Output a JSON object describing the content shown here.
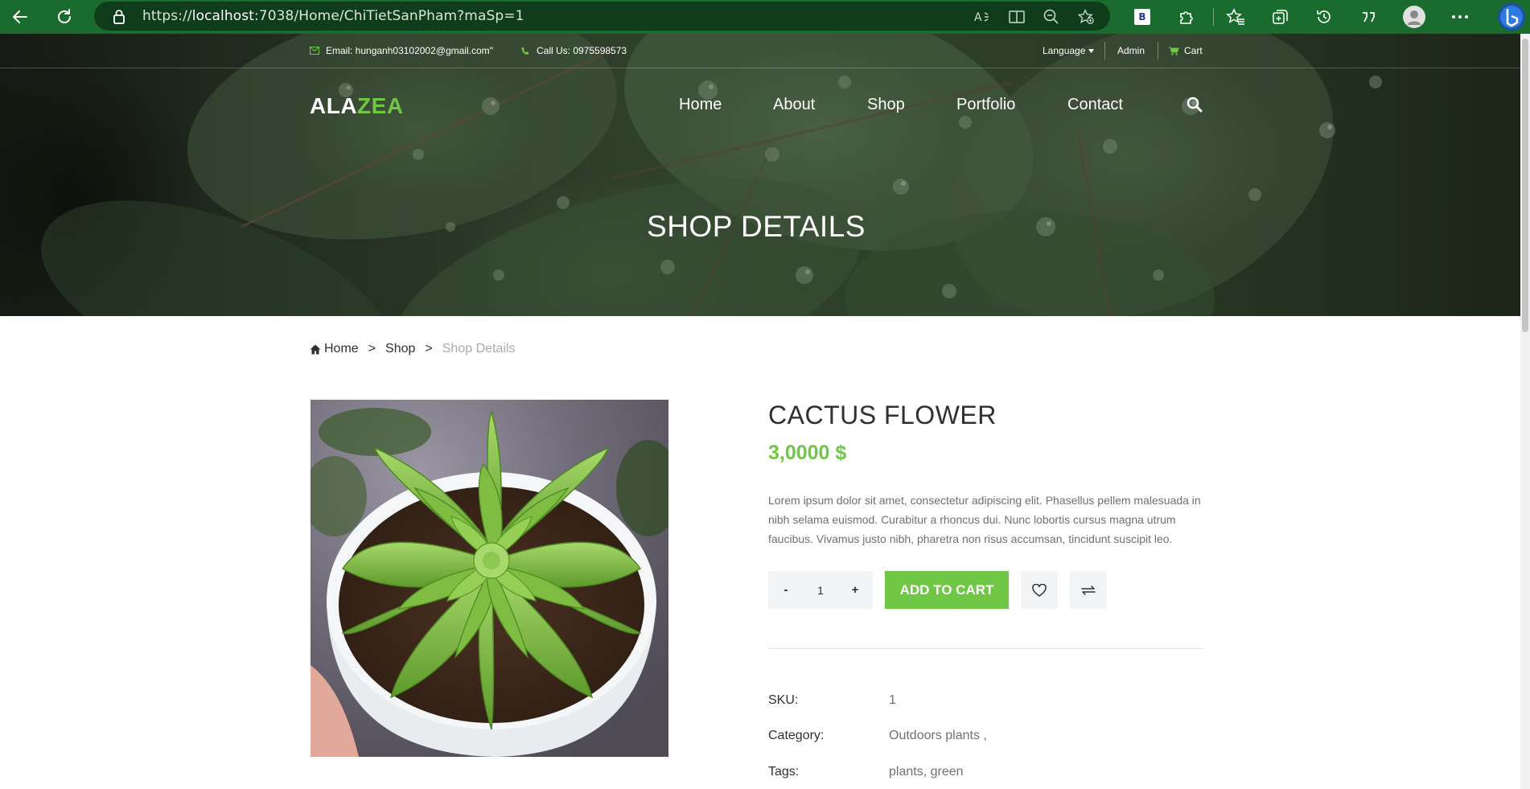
{
  "browser": {
    "url_prefix": "https://",
    "url_host": "localhost",
    "url_rest": ":7038/Home/ChiTietSanPham?maSp=1",
    "extension_badge": "B"
  },
  "topbar": {
    "email": "Email: hunganh03102002@gmail.com\"",
    "phone": "Call Us: 0975598573",
    "language": "Language",
    "admin": "Admin",
    "cart": "Cart"
  },
  "logo": {
    "part1": "ALA",
    "part2": "ZEA"
  },
  "nav": {
    "home": "Home",
    "about": "About",
    "shop": "Shop",
    "portfolio": "Portfolio",
    "contact": "Contact"
  },
  "hero": {
    "title": "SHOP DETAILS"
  },
  "breadcrumb": {
    "home": "Home",
    "shop": "Shop",
    "current": "Shop Details",
    "separator": ">"
  },
  "product": {
    "name": "CACTUS FLOWER",
    "price": "3,0000 $",
    "description": "Lorem ipsum dolor sit amet, consectetur adipiscing elit. Phasellus pellem malesuada in nibh selama euismod. Curabitur a rhoncus dui. Nunc lobortis cursus magna utrum faucibus. Vivamus justo nibh, pharetra non risus accumsan, tincidunt suscipit leo.",
    "quantity": "1",
    "minus": "-",
    "plus": "+",
    "add_to_cart": "ADD TO CART",
    "sku_label": "SKU:",
    "sku": "1",
    "category_label": "Category:",
    "category": "Outdoors plants ,",
    "tags_label": "Tags:",
    "tags": "plants, green"
  },
  "colors": {
    "accent": "#70c745",
    "chrome": "#1a6b2e",
    "text": "#303030",
    "muted": "#707070"
  }
}
